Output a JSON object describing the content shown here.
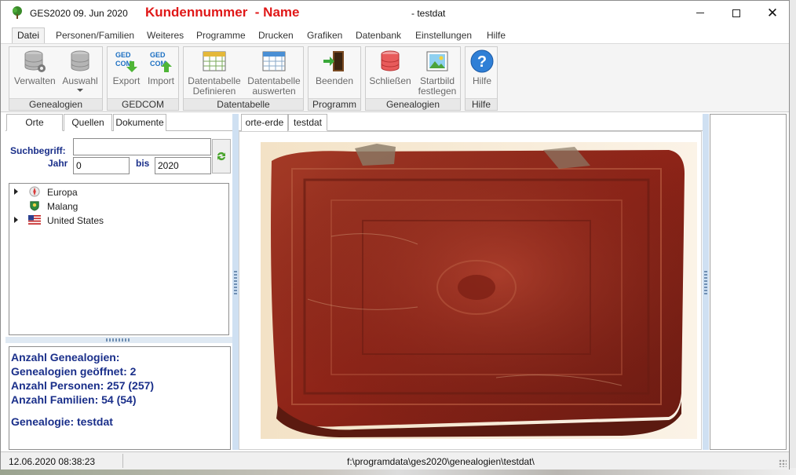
{
  "titlebar": {
    "app_name": "GES2020 09. Jun 2020",
    "customer_heading": "Kundennummer  - Name",
    "database_label": "- testdat",
    "minimize_glyph": "",
    "maximize_glyph": "",
    "close_glyph": "✕"
  },
  "menu": {
    "items": [
      "Datei",
      "Personen/Familien",
      "Weiteres",
      "Programme",
      "Drucken",
      "Grafiken",
      "Datenbank",
      "Einstellungen",
      "Hilfe"
    ]
  },
  "ribbon": {
    "groups": {
      "genealogien": {
        "label": "Genealogien",
        "buttons": {
          "verwalten": "Verwalten",
          "auswahl": "Auswahl"
        }
      },
      "gedcom": {
        "label": "GEDCOM",
        "buttons": {
          "export": "Export",
          "import": "Import"
        }
      },
      "datentabelle": {
        "label": "Datentabelle",
        "buttons": {
          "definieren_1": "Datentabelle",
          "definieren_2": "Definieren",
          "auswerten_1": "Datentabelle",
          "auswerten_2": "auswerten"
        }
      },
      "programm": {
        "label": "Programm",
        "buttons": {
          "beenden": "Beenden"
        }
      },
      "genealogien2": {
        "label": "Genealogien",
        "buttons": {
          "schliessen": "Schließen",
          "startbild_1": "Startbild",
          "startbild_2": "festlegen"
        }
      },
      "hilfe": {
        "label": "Hilfe",
        "buttons": {
          "hilfe": "Hilfe"
        }
      }
    },
    "gedcom_icon_text": "GED COM"
  },
  "left_panel": {
    "tabs": [
      "Orte",
      "Quellen",
      "Dokumente"
    ],
    "search": {
      "label_term": "Suchbegriff:",
      "label_year": "Jahr",
      "label_to": "bis",
      "term_value": "",
      "year_from": "0",
      "year_to": "2020"
    },
    "tree": [
      {
        "label": "Europa",
        "icon": "compass-globe-icon",
        "expandable": true
      },
      {
        "label": "Malang",
        "icon": "coat-of-arms-icon",
        "expandable": false
      },
      {
        "label": "United States",
        "icon": "us-flag-icon",
        "expandable": true
      }
    ],
    "stats": {
      "line1": "Anzahl Genealogien:",
      "line2": "Genealogien geöffnet: 2",
      "line3": "Anzahl Personen: 257 (257)",
      "line4": "Anzahl Familien: 54 (54)",
      "line5": "Genealogie: testdat"
    }
  },
  "center_panel": {
    "tabs": [
      "orte-erde",
      "testdat"
    ],
    "image": "old-red-leather-book-photo"
  },
  "statusbar": {
    "datetime": "12.06.2020 08:38:23",
    "path": "f:\\programdata\\ges2020\\genealogien\\testdat\\"
  },
  "colors": {
    "title_red": "#e01818",
    "stats_blue": "#1a2f8a",
    "book_red": "#8e2418"
  }
}
